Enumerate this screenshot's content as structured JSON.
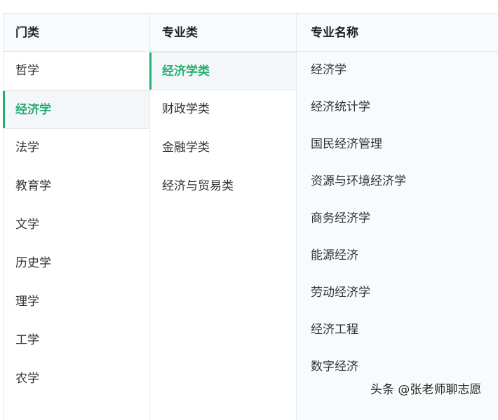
{
  "columns": {
    "category": {
      "header": "门类",
      "items": [
        "哲学",
        "经济学",
        "法学",
        "教育学",
        "文学",
        "历史学",
        "理学",
        "工学",
        "农学"
      ],
      "selected": 1
    },
    "subcategory": {
      "header": "专业类",
      "items": [
        "经济学类",
        "财政学类",
        "金融学类",
        "经济与贸易类"
      ],
      "selected": 0
    },
    "major": {
      "header": "专业名称",
      "items": [
        "经济学",
        "经济统计学",
        "国民经济管理",
        "资源与环境经济学",
        "商务经济学",
        "能源经济",
        "劳动经济学",
        "经济工程",
        "数字经济"
      ]
    }
  },
  "watermark": "头条 @张老师聊志愿",
  "colors": {
    "accent": "#27ad72"
  }
}
